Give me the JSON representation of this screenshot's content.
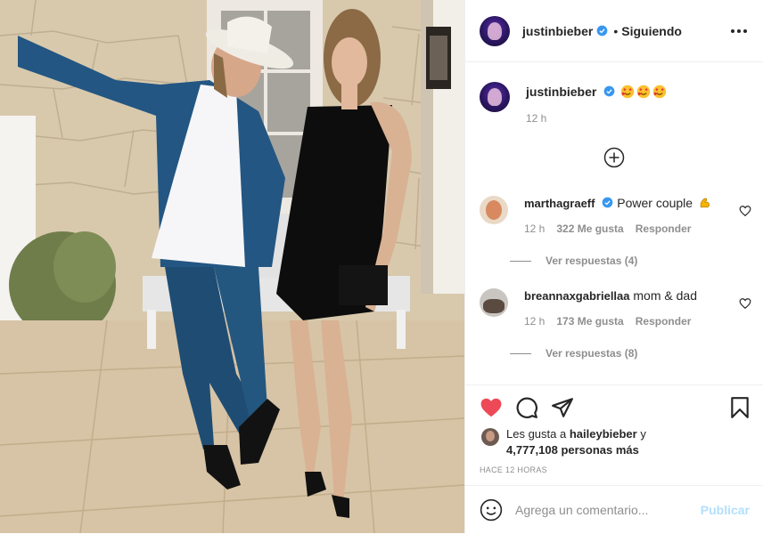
{
  "header": {
    "username": "justinbieber",
    "separator": "•",
    "follow_status": "Siguiendo"
  },
  "caption": {
    "username": "justinbieber",
    "emojis": [
      "smiling-face-with-hearts",
      "smiling-face-with-hearts",
      "smiling-face-with-hearts"
    ],
    "time": "12 h"
  },
  "comments": [
    {
      "username": "marthagraeff",
      "verified": true,
      "text": "Power couple",
      "emoji": "flexed-biceps",
      "time": "12 h",
      "likes": "322 Me gusta",
      "reply": "Responder",
      "view_replies": "Ver respuestas (4)"
    },
    {
      "username": "breannaxgabriellaa",
      "verified": false,
      "text": "mom & dad",
      "time": "12 h",
      "likes": "173 Me gusta",
      "reply": "Responder",
      "view_replies": "Ver respuestas (8)"
    }
  ],
  "likes": {
    "prefix": "Les gusta a",
    "user": "haileybieber",
    "and": "y",
    "count": "4,777,108 personas más"
  },
  "post_time": "HACE 12 HORAS",
  "add_comment": {
    "placeholder": "Agrega un comentario...",
    "publish_label": "Publicar"
  },
  "icons": {
    "like": "heart-filled-icon",
    "comment": "comment-icon",
    "share": "paper-plane-icon",
    "save": "bookmark-icon",
    "more": "more-options-icon",
    "emoji": "smiley-icon",
    "load_more": "plus-circle-icon"
  },
  "colors": {
    "like_red": "#ed4956",
    "verified_blue": "#3897f0",
    "publish_disabled": "#b2dffc",
    "muted_text": "#8e8e8e"
  }
}
